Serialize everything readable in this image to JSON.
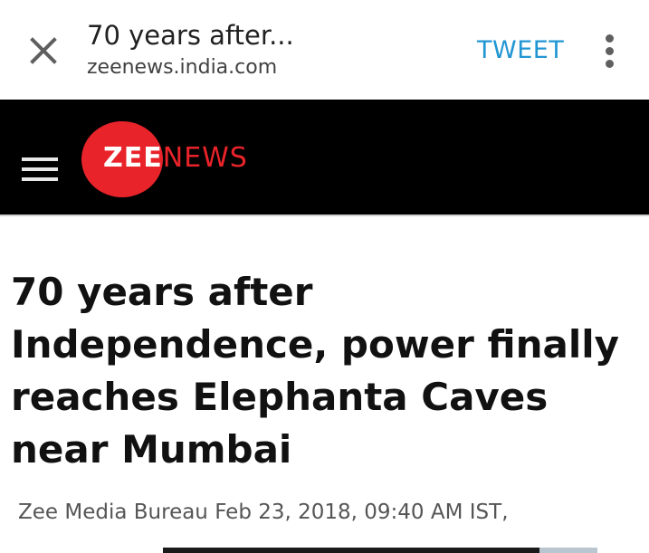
{
  "toolbar": {
    "title": "70 years after...",
    "url": "zeenews.india.com",
    "tweet_label": "TWEET",
    "close_icon": "close-icon",
    "more_icon": "more-vert-icon"
  },
  "site": {
    "logo_zee": "ZEE",
    "logo_news": "NEWS",
    "menu_icon": "hamburger-icon",
    "brand_color": "#e9232a",
    "masthead_color": "#000000"
  },
  "article": {
    "headline": "70 years after Independence, power finally reaches Elephanta Caves near Mumbai",
    "byline": "Zee Media Bureau Feb 23, 2018, 09:40 AM IST,"
  },
  "colors": {
    "tweet": "#2196d3",
    "text": "#111111"
  }
}
